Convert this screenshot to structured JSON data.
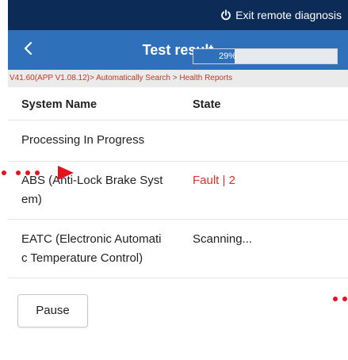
{
  "status_bar": {
    "exit_label": "Exit remote diagnosis",
    "icon": "power-icon"
  },
  "app_bar": {
    "title": "Test result",
    "back_icon": "chevron-left-icon"
  },
  "breadcrumb": "V41.60(APP V1.08.12)> Automatically Search > Health Reports",
  "table": {
    "headers": {
      "name": "System Name",
      "state": "State"
    },
    "rows": [
      {
        "name": "Processing In Progress",
        "progress_percent": 29,
        "progress_label": "29%"
      },
      {
        "name": "ABS (Anti-Lock Brake Syst\nem)",
        "state": "Fault | 2"
      },
      {
        "name": "EATC (Electronic Automati\nc Temperature Control)",
        "state": "Scanning..."
      }
    ]
  },
  "pause_label": "Pause",
  "colors": {
    "status_bar_bg": "#0d2b57",
    "app_bar_bg": "#2e70b9",
    "fault_red": "#d9342b",
    "breadcrumb_text": "#c0392b",
    "annotation_red": "#e5121b"
  }
}
